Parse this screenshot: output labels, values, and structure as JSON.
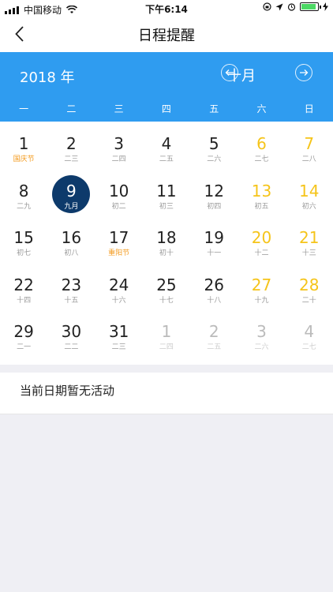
{
  "status": {
    "carrier": "中国移动",
    "time": "下午6:14"
  },
  "nav": {
    "title": "日程提醒"
  },
  "calendar": {
    "year_label": "2018 年",
    "month_label": "十月",
    "weekdays": [
      "一",
      "二",
      "三",
      "四",
      "五",
      "六",
      "日"
    ],
    "rows": [
      [
        {
          "d": "1",
          "l": "国庆节",
          "festival": true
        },
        {
          "d": "2",
          "l": "二三"
        },
        {
          "d": "3",
          "l": "二四"
        },
        {
          "d": "4",
          "l": "二五"
        },
        {
          "d": "5",
          "l": "二六"
        },
        {
          "d": "6",
          "l": "二七",
          "weekend": true
        },
        {
          "d": "7",
          "l": "二八",
          "weekend": true
        }
      ],
      [
        {
          "d": "8",
          "l": "二九"
        },
        {
          "d": "9",
          "l": "九月",
          "selected": true
        },
        {
          "d": "10",
          "l": "初二"
        },
        {
          "d": "11",
          "l": "初三"
        },
        {
          "d": "12",
          "l": "初四"
        },
        {
          "d": "13",
          "l": "初五",
          "weekend": true
        },
        {
          "d": "14",
          "l": "初六",
          "weekend": true
        }
      ],
      [
        {
          "d": "15",
          "l": "初七"
        },
        {
          "d": "16",
          "l": "初八"
        },
        {
          "d": "17",
          "l": "重阳节",
          "festival": true
        },
        {
          "d": "18",
          "l": "初十"
        },
        {
          "d": "19",
          "l": "十一"
        },
        {
          "d": "20",
          "l": "十二",
          "weekend": true
        },
        {
          "d": "21",
          "l": "十三",
          "weekend": true
        }
      ],
      [
        {
          "d": "22",
          "l": "十四"
        },
        {
          "d": "23",
          "l": "十五"
        },
        {
          "d": "24",
          "l": "十六"
        },
        {
          "d": "25",
          "l": "十七"
        },
        {
          "d": "26",
          "l": "十八"
        },
        {
          "d": "27",
          "l": "十九",
          "weekend": true
        },
        {
          "d": "28",
          "l": "二十",
          "weekend": true
        }
      ],
      [
        {
          "d": "29",
          "l": "二一"
        },
        {
          "d": "30",
          "l": "二二"
        },
        {
          "d": "31",
          "l": "二三"
        },
        {
          "d": "1",
          "l": "二四",
          "other": true
        },
        {
          "d": "2",
          "l": "二五",
          "other": true
        },
        {
          "d": "3",
          "l": "二六",
          "other": true
        },
        {
          "d": "4",
          "l": "二七",
          "other": true
        }
      ]
    ]
  },
  "empty_message": "当前日期暂无活动",
  "colors": {
    "header_blue": "#2f9cf0",
    "selected": "#0d3a6b",
    "weekend": "#f5c41a",
    "festival": "#f39a1d"
  }
}
